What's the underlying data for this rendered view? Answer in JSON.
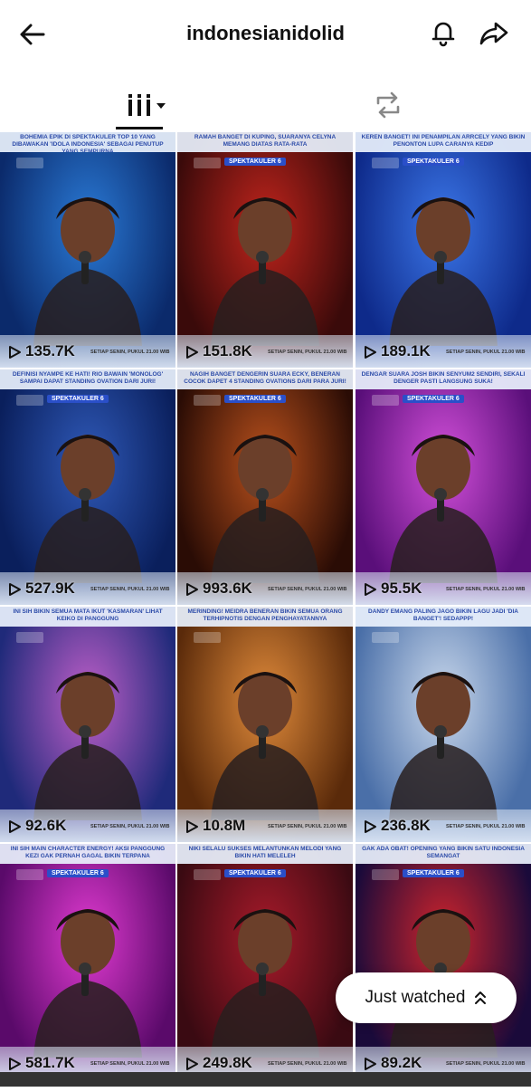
{
  "header": {
    "username": "indonesianidolid",
    "back_icon": "arrow-left-icon",
    "bell_icon": "bell-icon",
    "share_icon": "share-icon"
  },
  "tabs": {
    "grid_icon": "grid-dropdown-icon",
    "repost_icon": "repost-icon"
  },
  "videos": [
    {
      "caption": "BOHEMIA EPIK DI SPEKTAKULER TOP 10 YANG DIBAWAKAN 'IDOLA INDONESIA' SEBAGAI PENUTUP YANG SEMPURNA",
      "views": "135.7K",
      "tag": "",
      "colors": [
        "#0b2a6b",
        "#2a7ad6"
      ]
    },
    {
      "caption": "RAMAH BANGET DI KUPING, SUARANYA CELYNA MEMANG DIATAS RATA-RATA",
      "views": "151.8K",
      "tag": "SPEKTAKULER 6",
      "colors": [
        "#3a0a0a",
        "#c0241c"
      ]
    },
    {
      "caption": "KEREN BANGET! INI PENAMPILAN ARRCELY YANG BIKIN PENONTON LUPA CARANYA KEDIP",
      "views": "189.1K",
      "tag": "SPEKTAKULER 6",
      "colors": [
        "#0e2a8a",
        "#3b76e8"
      ]
    },
    {
      "caption": "DEFINISI NYAMPE KE HATI! RIO BAWAIN 'MONOLOG' SAMPAI DAPAT STANDING OVATION DARI JURI!",
      "views": "527.9K",
      "tag": "SPEKTAKULER 6",
      "colors": [
        "#0a1f5c",
        "#2f59b8"
      ]
    },
    {
      "caption": "NAGIH BANGET DENGERIN SUARA ECKY, BENERAN COCOK DAPET 4 STANDING OVATIONS DARI PARA JURI!",
      "views": "993.6K",
      "tag": "SPEKTAKULER 6",
      "colors": [
        "#2a0c05",
        "#b8501c"
      ]
    },
    {
      "caption": "DENGAR SUARA JOSH BIKIN SENYUM2 SENDIRI, SEKALI DENGER PASTI LANGSUNG SUKA!",
      "views": "95.5K",
      "tag": "SPEKTAKULER 6",
      "colors": [
        "#5a0f7a",
        "#d24fd9"
      ]
    },
    {
      "caption": "INI SIH BIKIN SEMUA MATA IKUT 'KASMARAN' LIHAT KEIKO DI PANGGUNG",
      "views": "92.6K",
      "tag": "",
      "colors": [
        "#1f2a7a",
        "#c05fc9"
      ]
    },
    {
      "caption": "MERINDING! MEIDRA BENERAN BIKIN SEMUA ORANG TERHIPNOTIS DENGAN PENGHAYATANNYA",
      "views": "10.8M",
      "tag": "",
      "colors": [
        "#5a2a0a",
        "#e08a3a"
      ]
    },
    {
      "caption": "DANDY EMANG PALING JAGO BIKIN LAGU JADI 'DIA BANGET'! SEDAPPP!",
      "views": "236.8K",
      "tag": "",
      "colors": [
        "#4a6fa8",
        "#c9d8ec"
      ]
    },
    {
      "caption": "INI SIH MAIN CHARACTER ENERGY! AKSI PANGGUNG KEZI GAK PERNAH GAGAL BIKIN TERPANA",
      "views": "581.7K",
      "tag": "SPEKTAKULER 6",
      "colors": [
        "#5a0a6a",
        "#e03ad0"
      ]
    },
    {
      "caption": "NIKI SELALU SUKSES MELANTUNKAN MELODI YANG BIKIN HATI MELELEH",
      "views": "249.8K",
      "tag": "SPEKTAKULER 6",
      "colors": [
        "#3a0a12",
        "#a81a2a"
      ]
    },
    {
      "caption": "GAK ADA OBAT! OPENING YANG BIKIN SATU INDONESIA SEMANGAT",
      "views": "89.2K",
      "tag": "SPEKTAKULER 6",
      "colors": [
        "#1a0a3a",
        "#d0242c"
      ]
    }
  ],
  "schedule_text": "SETIAP SENIN, PUKUL 21.00 WIB",
  "just_watched": {
    "label": "Just watched",
    "icon": "chevron-up-icon"
  }
}
